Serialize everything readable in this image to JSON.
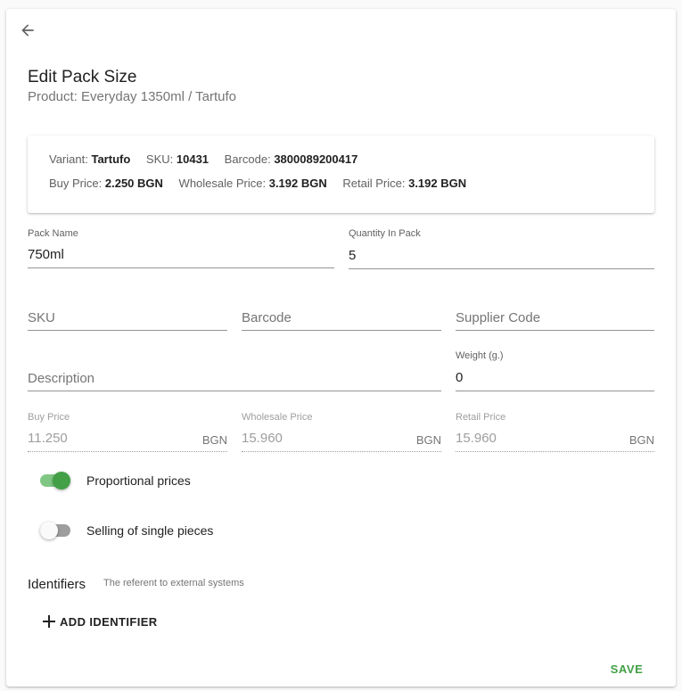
{
  "header": {
    "back_icon": "arrow-left-icon",
    "title": "Edit Pack Size",
    "subtitle": "Product: Everyday 1350ml / Tartufo"
  },
  "variant_info": {
    "variant_label": "Variant:",
    "variant_value": "Tartufo",
    "sku_label": "SKU:",
    "sku_value": "10431",
    "barcode_label": "Barcode:",
    "barcode_value": "3800089200417",
    "buy_price_label": "Buy Price:",
    "buy_price_value": "2.250 BGN",
    "wholesale_price_label": "Wholesale Price:",
    "wholesale_price_value": "3.192 BGN",
    "retail_price_label": "Retail Price:",
    "retail_price_value": "3.192 BGN"
  },
  "form": {
    "pack_name": {
      "label": "Pack Name",
      "value": "750ml"
    },
    "quantity_in_pack": {
      "label": "Quantity In Pack",
      "value": "5"
    },
    "sku": {
      "placeholder": "SKU"
    },
    "barcode": {
      "placeholder": "Barcode"
    },
    "supplier_code": {
      "placeholder": "Supplier Code"
    },
    "description": {
      "placeholder": "Description"
    },
    "weight": {
      "label": "Weight (g.)",
      "value": "0"
    },
    "buy_price": {
      "label": "Buy Price",
      "value": "11.250",
      "currency": "BGN"
    },
    "wholesale_price": {
      "label": "Wholesale Price",
      "value": "15.960",
      "currency": "BGN"
    },
    "retail_price": {
      "label": "Retail Price",
      "value": "15.960",
      "currency": "BGN"
    }
  },
  "toggles": {
    "proportional_prices": {
      "label": "Proportional prices",
      "on": true
    },
    "single_pieces": {
      "label": "Selling of single pieces",
      "on": false
    }
  },
  "identifiers": {
    "title": "Identifiers",
    "description": "The referent to external systems",
    "add_label": "ADD IDENTIFIER",
    "add_icon": "plus-icon"
  },
  "actions": {
    "save_label": "SAVE"
  },
  "colors": {
    "accent": "#43a047",
    "accent_light": "#81c784"
  }
}
